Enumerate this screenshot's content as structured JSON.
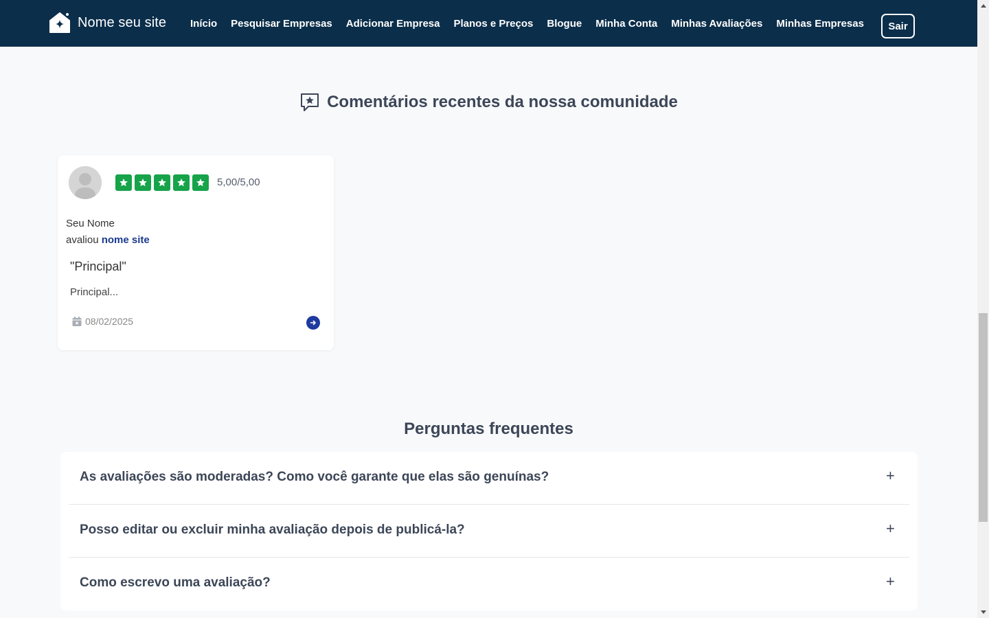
{
  "header": {
    "site_name": "Nome seu site",
    "nav": [
      "Início",
      "Pesquisar Empresas",
      "Adicionar Empresa",
      "Planos e Preços",
      "Blogue",
      "Minha Conta",
      "Minhas Avaliações",
      "Minhas Empresas"
    ],
    "logout_label": "Sair"
  },
  "reviews_section": {
    "title": "Comentários recentes da nossa comunidade",
    "icon": "review-star-icon"
  },
  "review": {
    "rating_text": "5,00/5,00",
    "stars": 5,
    "star_color": "#16a34a",
    "reviewer": "Seu Nome",
    "reviewed_prefix": "avaliou",
    "reviewed_target": "nome site",
    "title": "\"Principal\"",
    "excerpt": "Principal...",
    "date": "08/02/2025"
  },
  "faq": {
    "title": "Perguntas frequentes",
    "items": [
      "As avaliações são moderadas? Como você garante que elas são genuínas?",
      "Posso editar ou excluir minha avaliação depois de publicá-la?",
      "Como escrevo uma avaliação?"
    ]
  },
  "colors": {
    "header_bg": "#0b2e4a",
    "link": "#1a3a8f",
    "page_bg": "#f8f9fb"
  }
}
